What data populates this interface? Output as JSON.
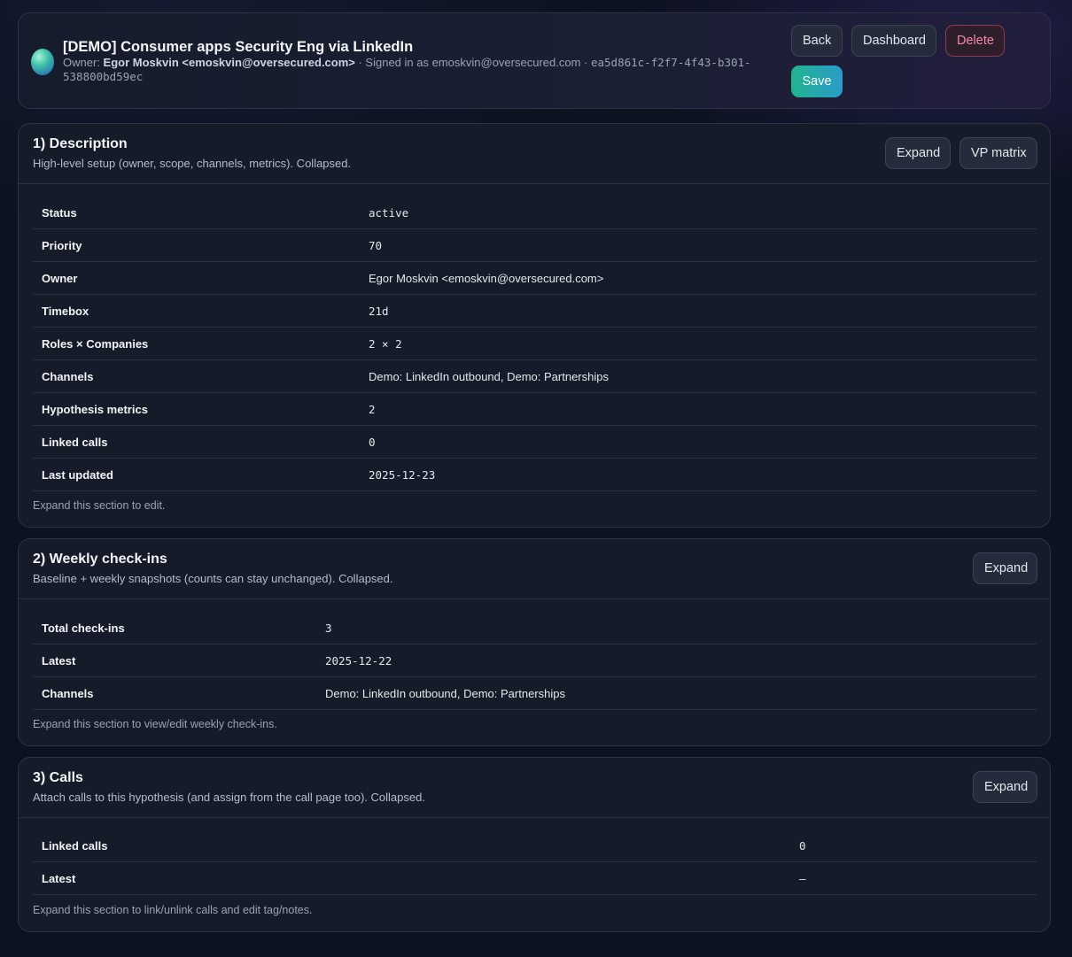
{
  "header": {
    "title": "[DEMO] Consumer apps Security Eng via LinkedIn",
    "owner_prefix": "Owner:",
    "owner_name": "Egor Moskvin <emoskvin@oversecured.com>",
    "signed_in": " · Signed in as emoskvin@oversecured.com · ",
    "record_id": "ea5d861c-f2f7-4f43-b301-538800bd59ec",
    "buttons": {
      "back": "Back",
      "dashboard": "Dashboard",
      "delete": "Delete",
      "save": "Save"
    }
  },
  "description": {
    "title": "1) Description",
    "subtitle": "High-level setup (owner, scope, channels, metrics). Collapsed.",
    "expand_label": "Expand",
    "vp_matrix_label": "VP matrix",
    "rows": [
      {
        "key": "Status",
        "value": "active"
      },
      {
        "key": "Priority",
        "value": "70"
      },
      {
        "key": "Owner",
        "value": "Egor Moskvin <emoskvin@oversecured.com>"
      },
      {
        "key": "Timebox",
        "value": "21d"
      },
      {
        "key": "Roles × Companies",
        "value": "2 × 2"
      },
      {
        "key": "Channels",
        "value": "Demo: LinkedIn outbound, Demo: Partnerships"
      },
      {
        "key": "Hypothesis metrics",
        "value": "2"
      },
      {
        "key": "Linked calls",
        "value": "0"
      },
      {
        "key": "Last updated",
        "value": "2025-12-23"
      }
    ],
    "footer": "Expand this section to edit."
  },
  "checkins": {
    "title": "2) Weekly check-ins",
    "subtitle": "Baseline + weekly snapshots (counts can stay unchanged). Collapsed.",
    "expand_label": "Expand",
    "rows": [
      {
        "key": "Total check-ins",
        "value": "3"
      },
      {
        "key": "Latest",
        "value": "2025-12-22"
      },
      {
        "key": "Channels",
        "value": "Demo: LinkedIn outbound, Demo: Partnerships"
      }
    ],
    "footer": "Expand this section to view/edit weekly check-ins."
  },
  "calls": {
    "title": "3) Calls",
    "subtitle": "Attach calls to this hypothesis (and assign from the call page too). Collapsed.",
    "expand_label": "Expand",
    "rows": [
      {
        "key": "Linked calls",
        "value": "0"
      },
      {
        "key": "Latest",
        "value": "—"
      }
    ],
    "footer": "Expand this section to link/unlink calls and edit tag/notes."
  },
  "colors": {
    "background": "#0d1220",
    "card": "#151b29",
    "accent_save_start": "#22b38d",
    "accent_save_end": "#2a9ccc",
    "delete": "#f08aa0"
  }
}
